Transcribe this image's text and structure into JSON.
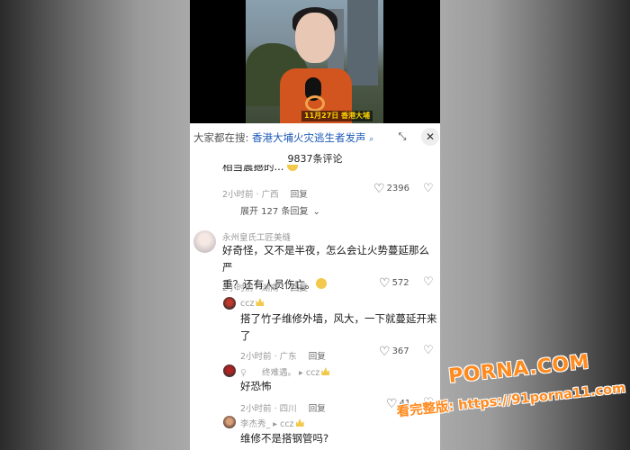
{
  "video": {
    "caption": "11月27日 香港大埔"
  },
  "search": {
    "prefix": "大家都在搜:",
    "query": "香港大埔火灾逃生者发声",
    "link_icon": "search-link-icon"
  },
  "comment_count": "9837条评论",
  "first_comment": {
    "partial_text": "相当震撼的...",
    "time": "2小时前",
    "location": "广西",
    "reply_label": "回复",
    "likes": "2396",
    "expand_label": "展开 127 条回复"
  },
  "comment_main": {
    "username": "永州皇氏工匠美缝",
    "text_line1": "好奇怪，又不是半夜，怎么会让火势蔓延那么严",
    "text_line2": "重？还有人员伤亡。",
    "time": "2小时前",
    "location": "湖南",
    "reply_label": "回复",
    "likes": "572"
  },
  "reply1": {
    "username": "ccz",
    "text_line1": "搭了竹子维修外墙，风大，一下就蔓延开来",
    "text_line2": "了",
    "time": "2小时前",
    "location": "广东",
    "reply_label": "回复",
    "likes": "367"
  },
  "reply2": {
    "username": "终难遇。",
    "reply_to": "ccz",
    "text": "好恐怖",
    "time": "2小时前",
    "location": "四川",
    "reply_label": "回复",
    "likes": "41"
  },
  "reply3": {
    "username": "李杰秀_",
    "reply_to": "ccz",
    "text": "维修不是搭钢管吗?"
  },
  "watermark": {
    "domain": "PORNA.COM",
    "url": "看完整版: https://91porna11.com"
  },
  "colors": {
    "link": "#1e5bb8",
    "watermark": "#ff8a1e"
  }
}
